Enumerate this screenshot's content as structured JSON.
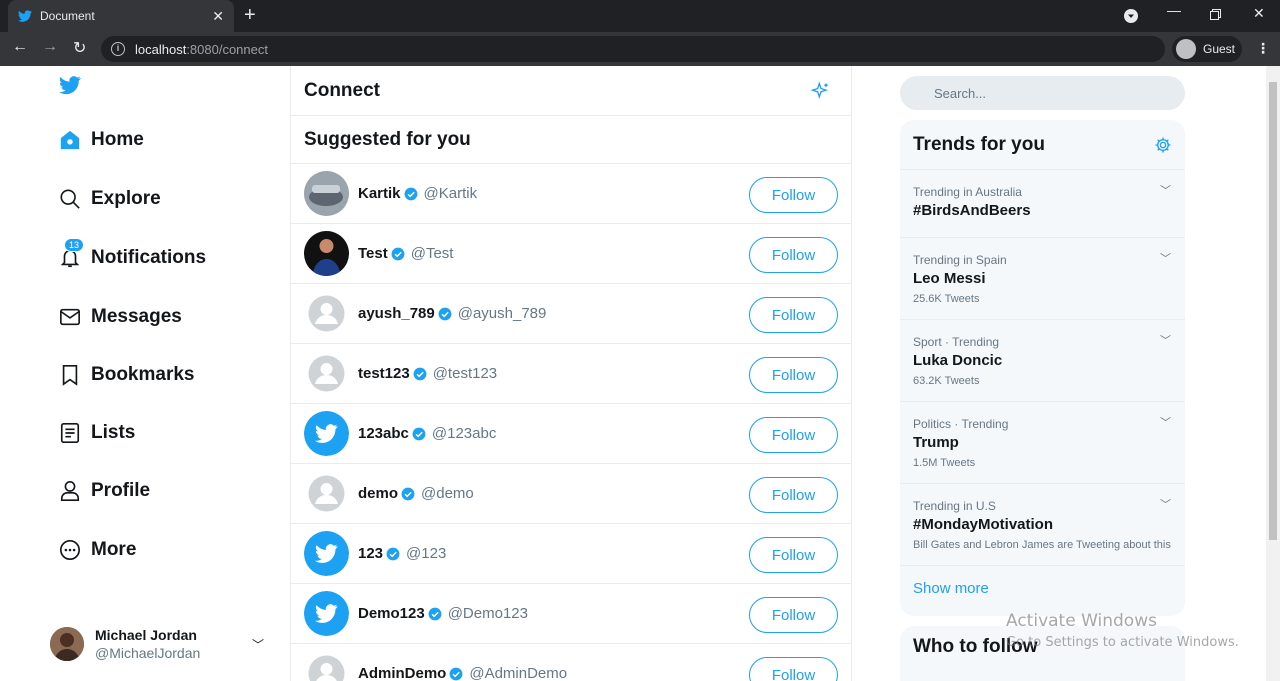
{
  "browser": {
    "tab_title": "Document",
    "url_host": "localhost",
    "url_rest": ":8080/connect",
    "profile_label": "Guest"
  },
  "nav": {
    "items": [
      {
        "label": "Home",
        "icon": "home-icon"
      },
      {
        "label": "Explore",
        "icon": "search-icon"
      },
      {
        "label": "Notifications",
        "icon": "bell-icon",
        "badge": "13"
      },
      {
        "label": "Messages",
        "icon": "mail-icon"
      },
      {
        "label": "Bookmarks",
        "icon": "bookmark-icon"
      },
      {
        "label": "Lists",
        "icon": "list-icon"
      },
      {
        "label": "Profile",
        "icon": "user-icon"
      },
      {
        "label": "More",
        "icon": "more-icon"
      }
    ],
    "account": {
      "name": "Michael Jordan",
      "handle": "@MichaelJordan"
    }
  },
  "main": {
    "title": "Connect",
    "section_title": "Suggested for you",
    "follow_label": "Follow",
    "users": [
      {
        "name": "Kartik",
        "handle": "@Kartik",
        "avatar": "photo-car"
      },
      {
        "name": "Test",
        "handle": "@Test",
        "avatar": "photo-person"
      },
      {
        "name": "ayush_789",
        "handle": "@ayush_789",
        "avatar": "default"
      },
      {
        "name": "test123",
        "handle": "@test123",
        "avatar": "default"
      },
      {
        "name": "123abc",
        "handle": "@123abc",
        "avatar": "twitter"
      },
      {
        "name": "demo",
        "handle": "@demo",
        "avatar": "default"
      },
      {
        "name": "123",
        "handle": "@123",
        "avatar": "twitter"
      },
      {
        "name": "Demo123",
        "handle": "@Demo123",
        "avatar": "twitter"
      },
      {
        "name": "AdminDemo",
        "handle": "@AdminDemo",
        "avatar": "default"
      }
    ]
  },
  "sidebar": {
    "search_placeholder": "Search...",
    "trends_title": "Trends for you",
    "trends": [
      {
        "context": "Trending in Australia",
        "name": "#BirdsAndBeers",
        "sub": ""
      },
      {
        "context": "Trending in Spain",
        "name": "Leo Messi",
        "sub": "25.6K Tweets"
      },
      {
        "context": "Sport · Trending",
        "name": "Luka Doncic",
        "sub": "63.2K Tweets"
      },
      {
        "context": "Politics · Trending",
        "name": "Trump",
        "sub": "1.5M Tweets"
      },
      {
        "context": "Trending in U.S",
        "name": "#MondayMotivation",
        "sub": "Bill Gates and Lebron James are Tweeting about this"
      }
    ],
    "show_more": "Show more",
    "who_to_follow": "Who to follow"
  },
  "watermark": {
    "line1": "Activate Windows",
    "line2": "Go to Settings to activate Windows."
  },
  "colors": {
    "accent": "#1da1f2",
    "chrome_dark": "#202124",
    "trend_panel": "#f5f8fa"
  }
}
